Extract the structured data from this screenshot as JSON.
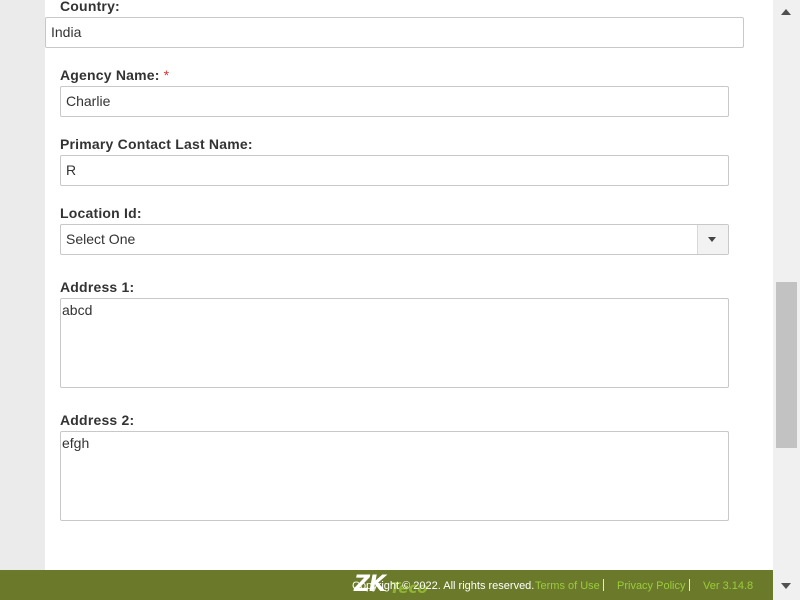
{
  "form": {
    "country": {
      "label": "Country:",
      "value": "India"
    },
    "agency_name": {
      "label": "Agency Name:",
      "required_mark": "*",
      "value": "Charlie"
    },
    "primary_contact_last_name": {
      "label": "Primary Contact Last Name:",
      "value": "R"
    },
    "location_id": {
      "label": "Location Id:",
      "selected": "Select One"
    },
    "address1": {
      "label": "Address 1:",
      "value": "abcd"
    },
    "address2": {
      "label": "Address 2:",
      "value": "efgh"
    }
  },
  "footer": {
    "logo_text": "ZK",
    "logo_suffix": "Teco",
    "copyright": "Copyright © 2022. All rights reserved.",
    "terms": "Terms of Use",
    "privacy": "Privacy Policy",
    "version": "Ver 3.14.8"
  },
  "colors": {
    "footer_bg": "#6b7a2a",
    "link_green": "#9ccc3c",
    "required_red": "#e03030"
  }
}
